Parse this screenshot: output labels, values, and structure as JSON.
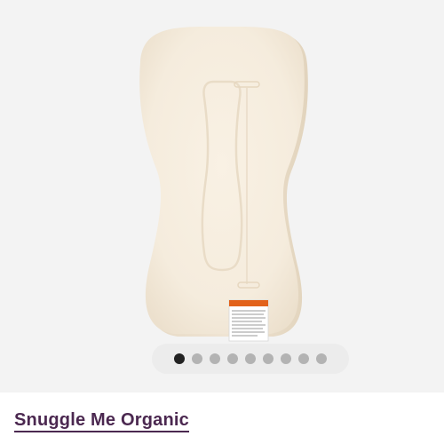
{
  "product": {
    "title": "Snuggle Me Organic",
    "image_alt": "Snuggle Me Organic lounger insert"
  },
  "carousel": {
    "total_slides": 9,
    "active_index": 0
  },
  "colors": {
    "title": "#4b2850",
    "dot_active": "#222222",
    "dot_inactive": "#b3b3b3",
    "dots_background": "#ececec",
    "image_background": "#f3f3f3",
    "pad": "#f5ecdd"
  },
  "icons": {
    "warning_label": "warning-label-icon"
  }
}
